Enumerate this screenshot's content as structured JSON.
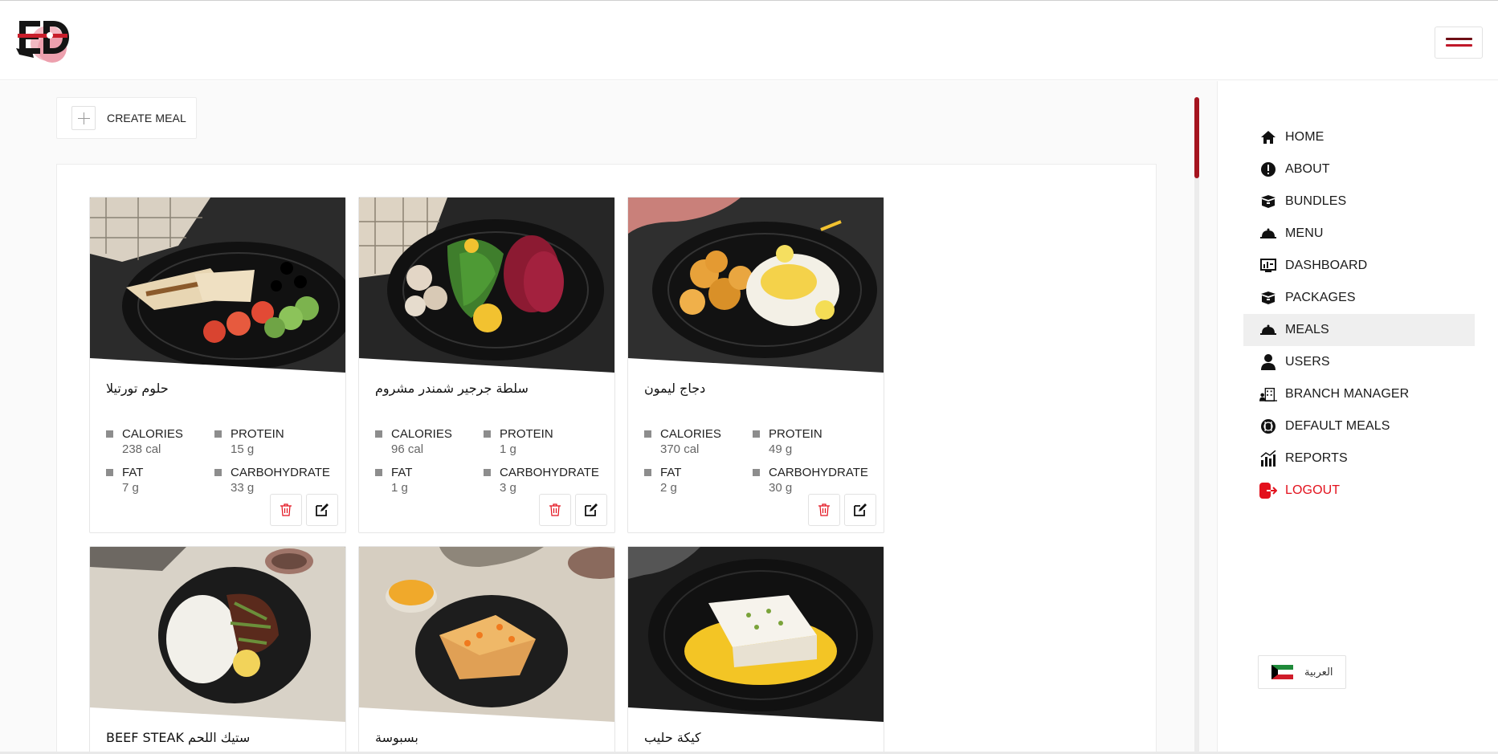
{
  "header": {
    "logo_icon": "ed-logo",
    "menu_icon": "hamburger-icon"
  },
  "toolbar": {
    "create_label": "CREATE MEAL",
    "create_icon": "plus-icon"
  },
  "meals": [
    {
      "name": "حلوم تورتيلا",
      "stats": [
        {
          "label": "CALORIES",
          "value": "238 cal"
        },
        {
          "label": "PROTEIN",
          "value": "15 g"
        },
        {
          "label": "FAT",
          "value": "7 g"
        },
        {
          "label": "CARBOHYDRATE",
          "value": "33 g"
        }
      ]
    },
    {
      "name": "سلطة جرجير شمندر مشروم",
      "stats": [
        {
          "label": "CALORIES",
          "value": "96 cal"
        },
        {
          "label": "PROTEIN",
          "value": "1 g"
        },
        {
          "label": "FAT",
          "value": "1 g"
        },
        {
          "label": "CARBOHYDRATE",
          "value": "3 g"
        }
      ]
    },
    {
      "name": "دجاج ليمون",
      "stats": [
        {
          "label": "CALORIES",
          "value": "370 cal"
        },
        {
          "label": "PROTEIN",
          "value": "49 g"
        },
        {
          "label": "FAT",
          "value": "2 g"
        },
        {
          "label": "CARBOHYDRATE",
          "value": "30 g"
        }
      ]
    },
    {
      "name": "BEEF STEAK ستيك اللحم"
    },
    {
      "name": "بسبوسة"
    },
    {
      "name": "كيكة حليب"
    }
  ],
  "sidebar": {
    "items": [
      {
        "label": "HOME",
        "icon": "home-icon"
      },
      {
        "label": "ABOUT",
        "icon": "info-icon"
      },
      {
        "label": "BUNDLES",
        "icon": "box-icon"
      },
      {
        "label": "MENU",
        "icon": "cloche-icon"
      },
      {
        "label": "DASHBOARD",
        "icon": "dashboard-icon"
      },
      {
        "label": "PACKAGES",
        "icon": "box-icon"
      },
      {
        "label": "MEALS",
        "icon": "cloche-icon"
      },
      {
        "label": "USERS",
        "icon": "user-icon"
      },
      {
        "label": "BRANCH MANAGER",
        "icon": "building-icon"
      },
      {
        "label": "DEFAULT MEALS",
        "icon": "utensils-icon"
      },
      {
        "label": "REPORTS",
        "icon": "chart-icon"
      },
      {
        "label": "LOGOUT",
        "icon": "logout-icon"
      }
    ],
    "active": "MEALS",
    "language_label": "العربية",
    "language_icon": "kuwait-flag-icon",
    "logout_color": "#e3111d"
  },
  "colors": {
    "accent": "#a5141f",
    "danger": "#e3111d"
  }
}
